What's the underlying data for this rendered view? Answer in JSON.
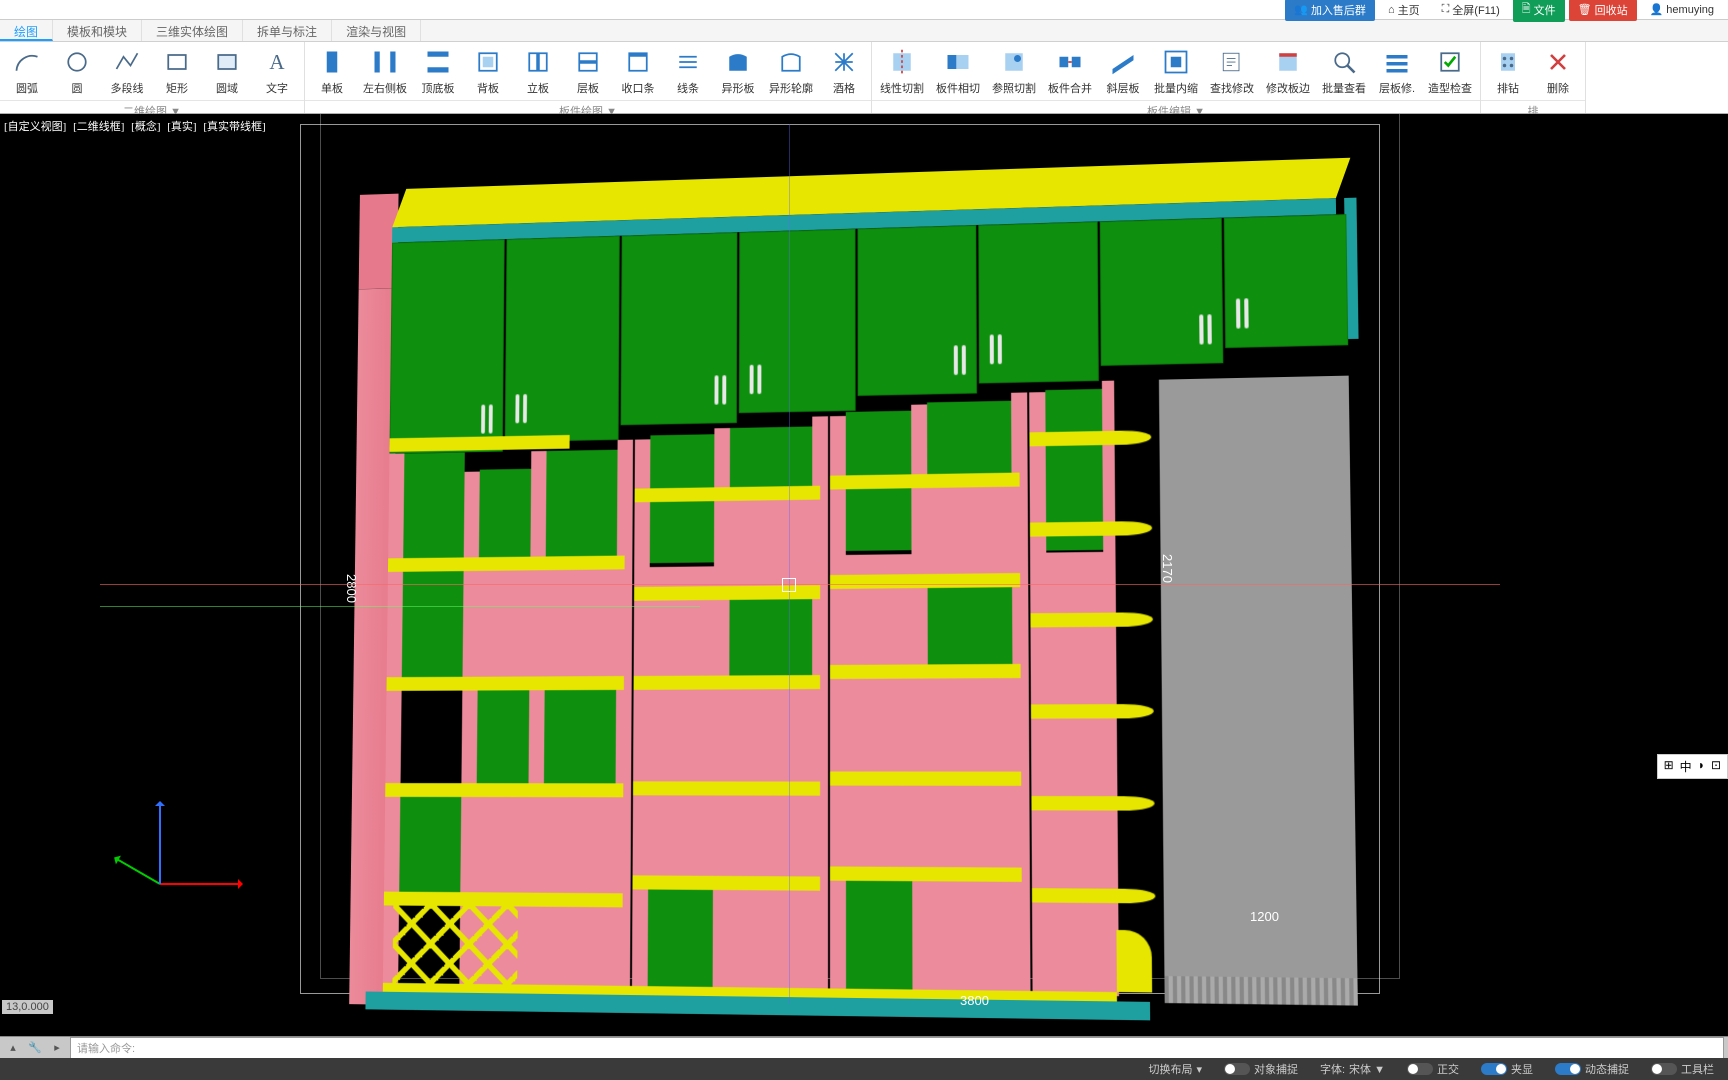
{
  "header": {
    "join_group": "加入售后群",
    "home": "主页",
    "fullscreen": "全屏(F11)",
    "file": "文件",
    "recycle": "回收站",
    "user": "hemuying"
  },
  "tabs": [
    "绘图",
    "模板和模块",
    "三维实体绘图",
    "拆单与标注",
    "渲染与视图"
  ],
  "ribbon": {
    "group1_title": "二维绘图 ▼",
    "group2_title": "板件绘图 ▼",
    "group3_title": "板件编辑 ▼",
    "group4_title": "排",
    "items1": [
      {
        "label": "圆弧",
        "icon": "arc"
      },
      {
        "label": "圆",
        "icon": "circle"
      },
      {
        "label": "多段线",
        "icon": "polyline"
      },
      {
        "label": "矩形",
        "icon": "rect"
      },
      {
        "label": "圆域",
        "icon": "region"
      },
      {
        "label": "文字",
        "icon": "text"
      }
    ],
    "items2": [
      {
        "label": "单板",
        "icon": "panel"
      },
      {
        "label": "左右侧板",
        "icon": "lrside"
      },
      {
        "label": "顶底板",
        "icon": "topbot"
      },
      {
        "label": "背板",
        "icon": "back"
      },
      {
        "label": "立板",
        "icon": "vert"
      },
      {
        "label": "层板",
        "icon": "shelf"
      },
      {
        "label": "收口条",
        "icon": "strip"
      },
      {
        "label": "线条",
        "icon": "line"
      },
      {
        "label": "异形板",
        "icon": "special"
      },
      {
        "label": "异形轮廓",
        "icon": "outline"
      },
      {
        "label": "酒格",
        "icon": "wine"
      }
    ],
    "items3": [
      {
        "label": "线性切割",
        "icon": "lcut"
      },
      {
        "label": "板件相切",
        "icon": "pcut"
      },
      {
        "label": "参照切割",
        "icon": "rcut"
      },
      {
        "label": "板件合并",
        "icon": "merge"
      },
      {
        "label": "斜层板",
        "icon": "slant"
      },
      {
        "label": "批量内缩",
        "icon": "bshrink"
      },
      {
        "label": "查找修改",
        "icon": "find"
      },
      {
        "label": "修改板边",
        "icon": "edge"
      },
      {
        "label": "批量查看",
        "icon": "bview"
      },
      {
        "label": "层板修.",
        "icon": "srepair"
      },
      {
        "label": "造型检查",
        "icon": "check"
      }
    ],
    "items4": [
      {
        "label": "排钻",
        "icon": "drill"
      },
      {
        "label": "删除",
        "icon": "del"
      }
    ]
  },
  "viewport": {
    "labels": [
      "[自定义视图]",
      "[二维线框]",
      "[概念]",
      "[真实]",
      "[真实带线框]"
    ]
  },
  "dimensions": {
    "height": "2800",
    "width": "3800",
    "right_h": "2170",
    "right_w": "1200"
  },
  "right_widget": [
    "⊞",
    "中",
    "◗",
    "⊡"
  ],
  "command": {
    "coord": "13,0.000",
    "placeholder": "请输入命令:"
  },
  "status": {
    "layout": "切换布局",
    "snap": "对象捕捉",
    "font_label": "字体:",
    "font_value": "宋体 ▼",
    "ortho": "正交",
    "overlap": "夹显",
    "dynsnap": "动态捕捉",
    "toolbar": "工具栏"
  }
}
